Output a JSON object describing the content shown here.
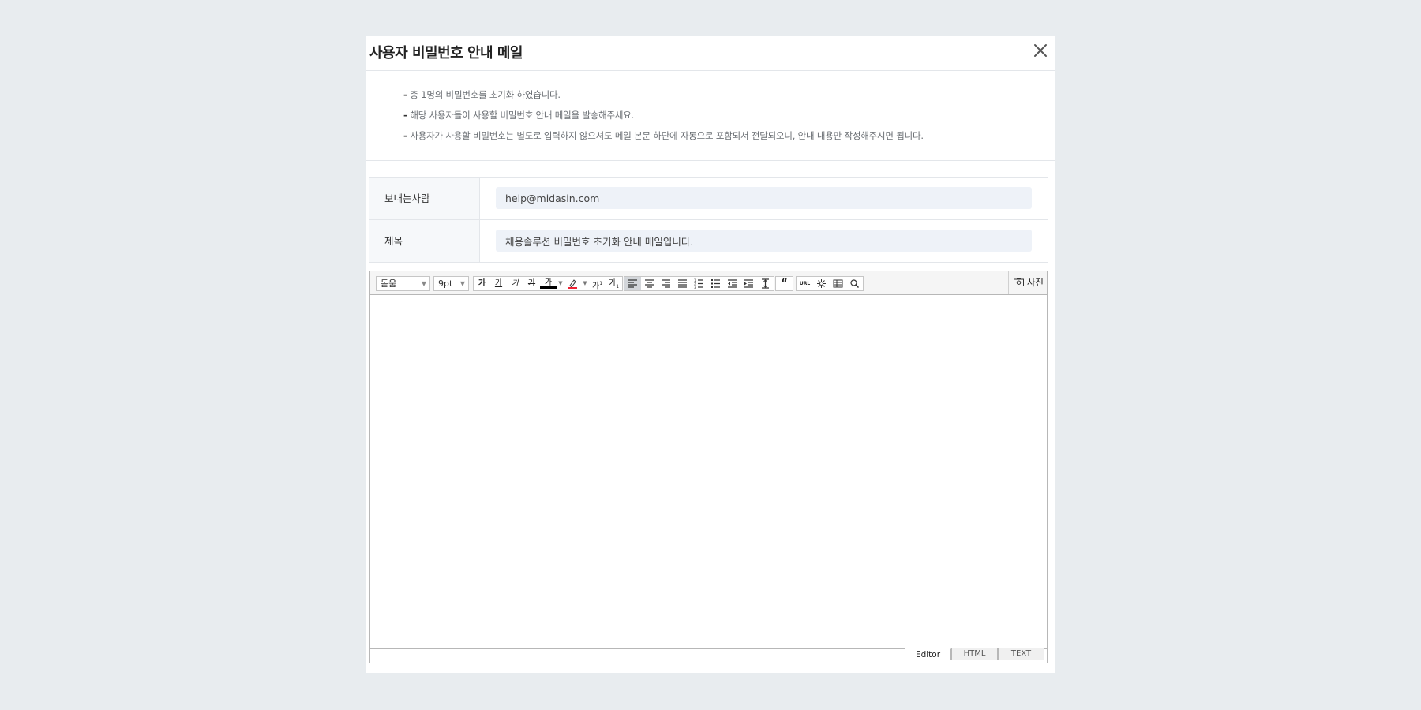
{
  "modal": {
    "title": "사용자 비밀번호 안내 메일",
    "close_icon": "close-icon"
  },
  "notice": {
    "lines": [
      "총 1명의 비밀번호를 초기화 하였습니다.",
      "해당 사용자들이 사용할 비밀번호 안내 메일을 발송해주세요.",
      "사용자가 사용할 비밀번호는 별도로 입력하지 않으셔도 메일 본문 하단에 자동으로 포함되서 전달되오니, 안내 내용만 작성해주시면 됩니다."
    ]
  },
  "form": {
    "sender_label": "보내는사람",
    "sender_value": "help@midasin.com",
    "subject_label": "제목",
    "subject_value": "채용솔루션 비밀번호 초기화 안내 메일입니다."
  },
  "editor": {
    "font_family": "돋움",
    "font_size": "9pt",
    "style_buttons": [
      "가",
      "가",
      "가",
      "가",
      "가"
    ],
    "superscript": "가",
    "subscript": "가",
    "url_label": "URL",
    "photo_label": "사진",
    "modes": [
      "Editor",
      "HTML",
      "TEXT"
    ],
    "active_mode": "Editor"
  },
  "colors": {
    "background": "#e8ecef",
    "input_fill": "#eef2f8",
    "label_fill": "#f6f8fa"
  }
}
